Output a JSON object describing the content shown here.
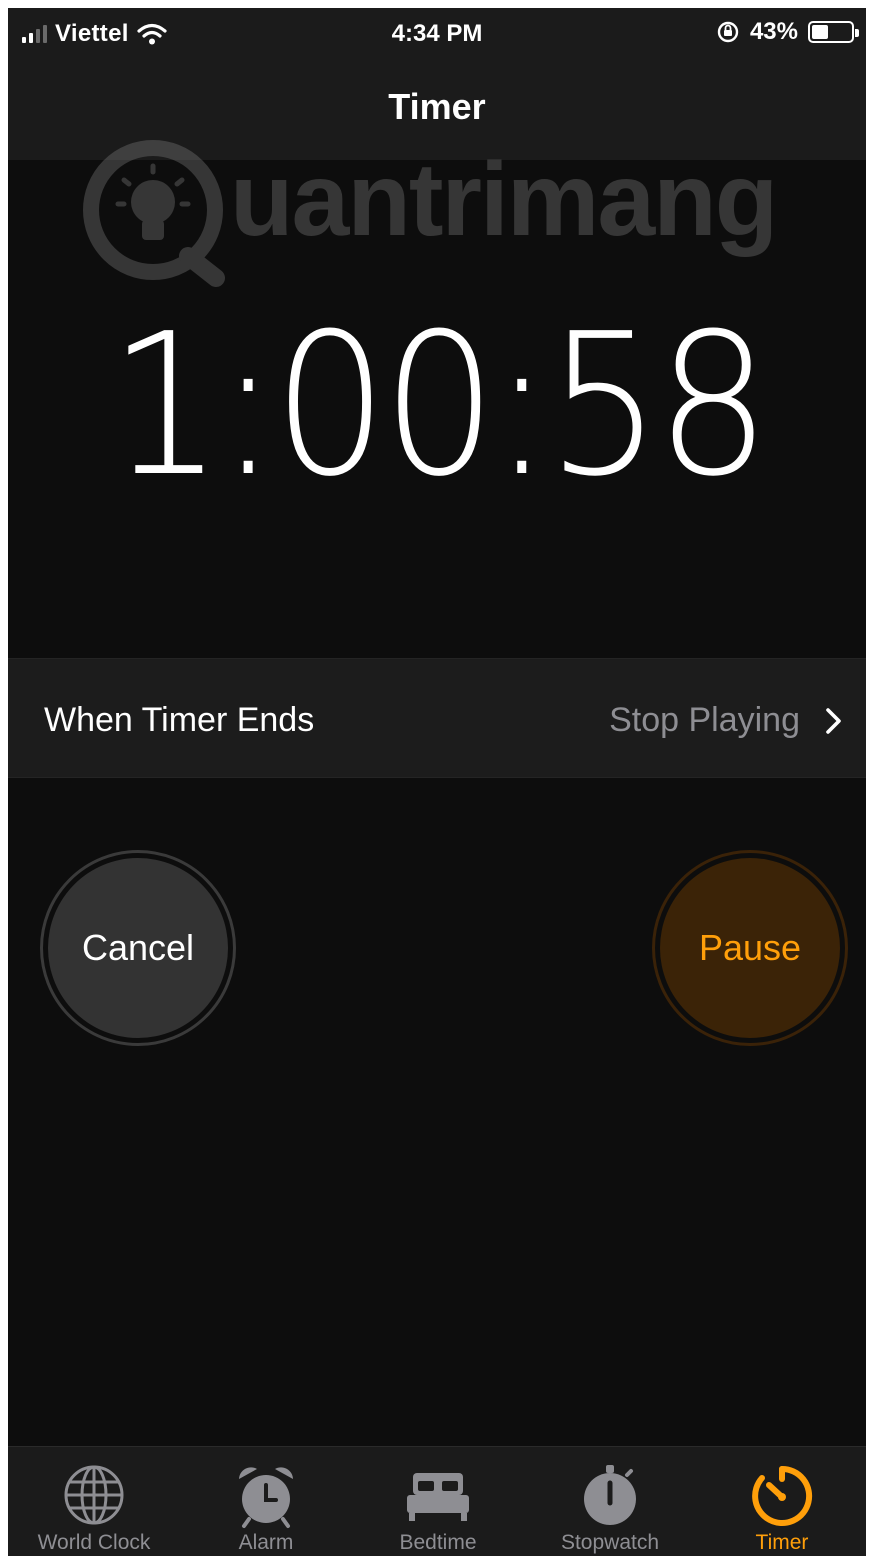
{
  "status_bar": {
    "carrier": "Viettel",
    "time": "4:34 PM",
    "battery_percent": "43%",
    "battery_level": 0.43,
    "icons": [
      "signal-icon",
      "wifi-icon",
      "orientation-lock-icon",
      "battery-icon"
    ]
  },
  "nav": {
    "title": "Timer"
  },
  "watermark": {
    "text": "uantrimang"
  },
  "timer": {
    "remaining": "1:00:58"
  },
  "when_timer_ends": {
    "label": "When Timer Ends",
    "value": "Stop Playing"
  },
  "buttons": {
    "cancel": "Cancel",
    "pause": "Pause"
  },
  "tabs": [
    {
      "label": "World Clock",
      "icon": "globe-icon",
      "active": false
    },
    {
      "label": "Alarm",
      "icon": "alarm-clock-icon",
      "active": false
    },
    {
      "label": "Bedtime",
      "icon": "bed-icon",
      "active": false
    },
    {
      "label": "Stopwatch",
      "icon": "stopwatch-icon",
      "active": false
    },
    {
      "label": "Timer",
      "icon": "timer-icon",
      "active": true
    }
  ],
  "colors": {
    "background": "#0d0d0d",
    "bar_background": "#1b1b1b",
    "accent": "#ff9f0a",
    "secondary_text": "#8e8e93"
  }
}
